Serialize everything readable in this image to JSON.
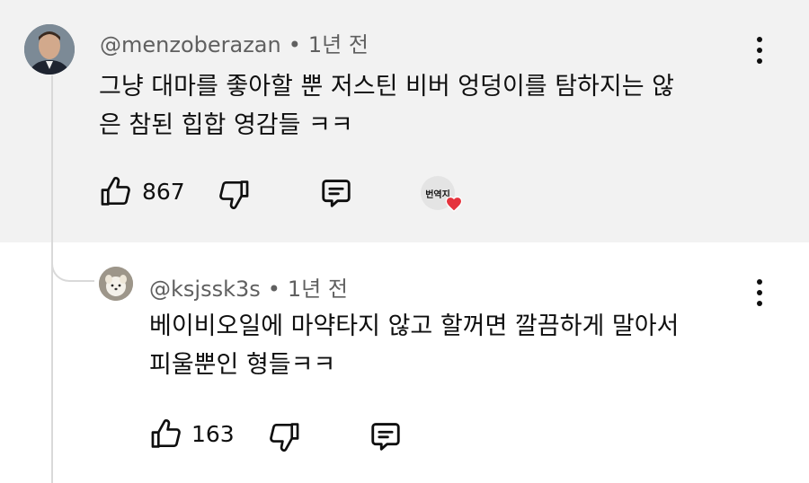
{
  "comment": {
    "author": "@menzoberazan",
    "separator": "•",
    "time": "1년 전",
    "text_line1": "그냥 대마를 좋아할 뿐 저스틴 비버 엉덩이를 탐하지는 않",
    "text_line2": "은 참된 힙합 영감들 ㅋㅋ",
    "like_count": "867",
    "creator_badge_text": "번역지"
  },
  "reply": {
    "author": "@ksjssk3s",
    "separator": "•",
    "time": "1년 전",
    "text_line1": "베이비오일에 마약타지 않고 할꺼면 깔끔하게 말아서",
    "text_line2": "피울뿐인 형들ㅋㅋ",
    "like_count": "163"
  },
  "colors": {
    "top_background": "#f2f2f2",
    "meta_text": "#606060",
    "heart": "#e5333d"
  }
}
